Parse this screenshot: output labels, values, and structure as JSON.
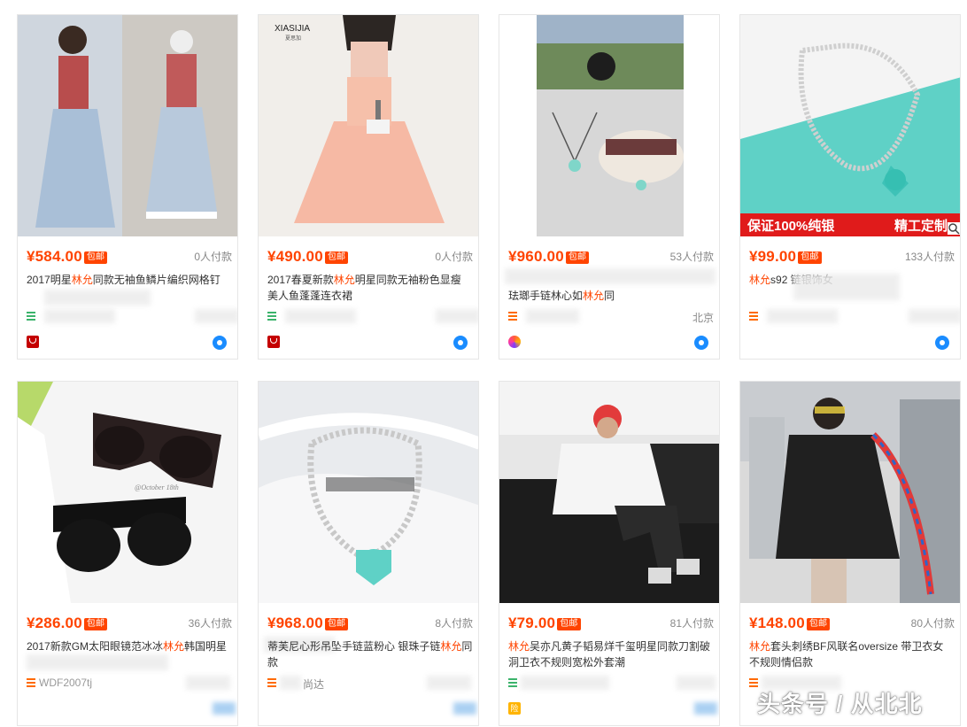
{
  "products": [
    {
      "price": "¥584.00",
      "free_shipping": "包邮",
      "sold": "0人付款",
      "title_pre": "2017明星",
      "title_hl": "林允",
      "title_post": "同款无袖鱼鳞片编织网格钉",
      "shop": "",
      "location": "",
      "badge": "tmall"
    },
    {
      "price": "¥490.00",
      "free_shipping": "包邮",
      "sold": "0人付款",
      "title_pre": "2017春夏新款",
      "title_hl": "林允",
      "title_post": "明星同款无袖粉色显瘦 美人鱼蓬蓬连衣裙",
      "shop": "",
      "location": "",
      "badge": "tmall",
      "image_logo": "XIASIJIA",
      "image_logo_sub": "夏思加"
    },
    {
      "price": "¥960.00",
      "free_shipping": "包邮",
      "sold": "53人付款",
      "title_pre": "珐瑯手链林心如",
      "title_hl": "林允",
      "title_post": "同",
      "shop": "",
      "location": "北京",
      "badge": "swirl"
    },
    {
      "price": "¥99.00",
      "free_shipping": "包邮",
      "sold": "133人付款",
      "title_pre": "",
      "title_hl": "林允",
      "title_post": "s92 链银饰女",
      "shop": "",
      "location": "",
      "badge": "none",
      "overlay_left": "保证100%纯银",
      "overlay_right": "精工定制"
    },
    {
      "price": "¥286.00",
      "free_shipping": "包邮",
      "sold": "36人付款",
      "title_pre": "2017新款GM太阳眼镜范冰冰",
      "title_hl": "林允",
      "title_post": "韩国明星",
      "shop": "WDF2007tj",
      "location": "",
      "badge": "none",
      "image_caption": "@October 18th"
    },
    {
      "price": "¥968.00",
      "free_shipping": "包邮",
      "sold": "8人付款",
      "title_pre": "蒂芙尼心形吊坠手链蓝粉心 银珠子链",
      "title_hl": "林允",
      "title_post": "同款",
      "shop": "尚达",
      "location": "",
      "badge": "none"
    },
    {
      "price": "¥79.00",
      "free_shipping": "包邮",
      "sold": "81人付款",
      "title_pre": "",
      "title_hl": "林允",
      "title_post": "吴亦凡黄子韬易烊千玺明星同款刀割破洞卫衣不规则宽松外套潮",
      "shop": "",
      "location": "",
      "badge": "gold",
      "badge_text": "险"
    },
    {
      "price": "¥148.00",
      "free_shipping": "包邮",
      "sold": "80人付款",
      "title_pre": "",
      "title_hl": "林允",
      "title_post": "套头刺绣BF风联名oversize 带卫衣女 不规则情侣款",
      "shop": "",
      "location": "",
      "badge": "none"
    }
  ],
  "watermark": "头条号 / 从北北",
  "colors": {
    "price": "#ff4400",
    "border": "#e6e6e6",
    "highlight": "#ff4400"
  }
}
